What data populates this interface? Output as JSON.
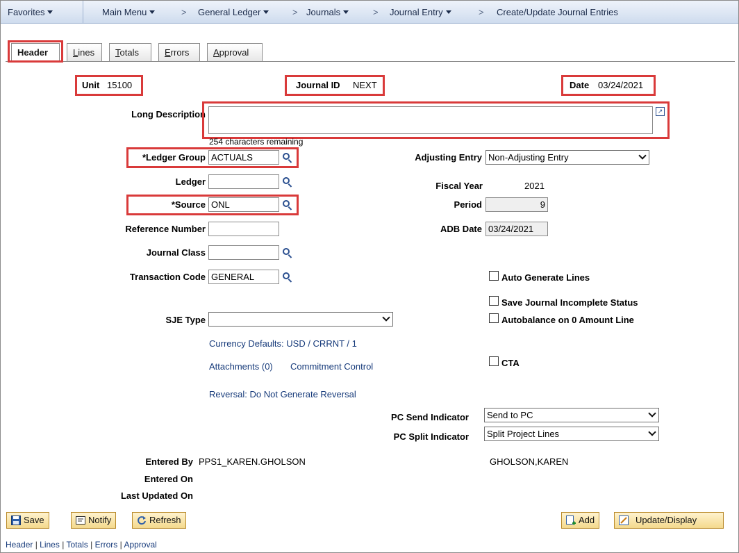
{
  "breadcrumb": {
    "favorites": "Favorites",
    "main_menu": "Main Menu",
    "general_ledger": "General Ledger",
    "journals": "Journals",
    "journal_entry": "Journal Entry",
    "page": "Create/Update Journal Entries",
    "separator": ">"
  },
  "tabs": [
    {
      "label_u": "",
      "label": "Header"
    },
    {
      "label_u": "L",
      "label": "ines"
    },
    {
      "label_u": "T",
      "label": "otals"
    },
    {
      "label_u": "E",
      "label": "rrors"
    },
    {
      "label_u": "A",
      "label": "pproval"
    }
  ],
  "header": {
    "unit_label": "Unit",
    "unit_value": "15100",
    "journal_id_label": "Journal ID",
    "journal_id_value": "NEXT",
    "date_label": "Date",
    "date_value": "03/24/2021"
  },
  "form": {
    "long_description_label": "Long Description",
    "long_description_value": "",
    "chars_remaining": "254 characters remaining",
    "ledger_group_label": "*Ledger Group",
    "ledger_group_value": "ACTUALS",
    "ledger_label": "Ledger",
    "ledger_value": "",
    "source_label": "*Source",
    "source_value": "ONL",
    "reference_number_label": "Reference Number",
    "reference_number_value": "",
    "journal_class_label": "Journal Class",
    "journal_class_value": "",
    "transaction_code_label": "Transaction Code",
    "transaction_code_value": "GENERAL",
    "sje_type_label": "SJE Type",
    "sje_type_value": "",
    "adjusting_entry_label": "Adjusting Entry",
    "adjusting_entry_value": "Non-Adjusting Entry",
    "fiscal_year_label": "Fiscal Year",
    "fiscal_year_value": "2021",
    "period_label": "Period",
    "period_value": "9",
    "adb_date_label": "ADB Date",
    "adb_date_value": "03/24/2021",
    "auto_generate_lines": "Auto Generate Lines",
    "save_incomplete": "Save Journal Incomplete Status",
    "autobalance": "Autobalance on 0 Amount Line",
    "cta": "CTA",
    "pc_send_label": "PC Send Indicator",
    "pc_send_value": "Send to PC",
    "pc_split_label": "PC Split Indicator",
    "pc_split_value": "Split Project Lines"
  },
  "links": {
    "currency_defaults": "Currency Defaults: USD / CRRNT / 1",
    "attachments": "Attachments (0)",
    "commitment_control": "Commitment Control",
    "reversal": "Reversal: Do Not Generate Reversal"
  },
  "audit": {
    "entered_by_label": "Entered By",
    "entered_by_value": "PPS1_KAREN.GHOLSON",
    "entered_by_name": "GHOLSON,KAREN",
    "entered_on_label": "Entered On",
    "last_updated_label": "Last Updated On"
  },
  "buttons": {
    "save": "Save",
    "notify": "Notify",
    "refresh": "Refresh",
    "add": "Add",
    "update_display": "Update/Display"
  },
  "footer": {
    "header": "Header",
    "lines": "Lines",
    "totals": "Totals",
    "errors": "Errors",
    "approval": "Approval",
    "sep": "|"
  },
  "icons": {
    "lookup": "magnifier-lookup-icon",
    "expand": "expand-textarea-icon"
  },
  "colors": {
    "highlight": "#d93a3a",
    "link": "#163a7a",
    "button": "#f4d98c"
  }
}
